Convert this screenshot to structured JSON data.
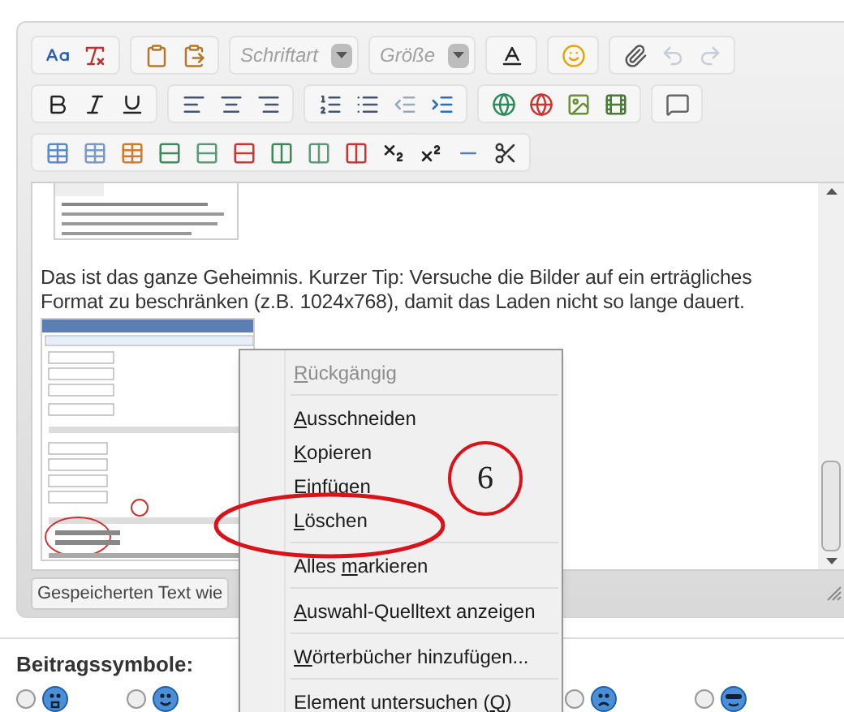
{
  "toolbar": {
    "font_select": {
      "placeholder": "Schriftart"
    },
    "size_select": {
      "placeholder": "Größe"
    },
    "undo": {
      "disabled": true
    },
    "redo": {
      "disabled": true
    }
  },
  "editor": {
    "paragraph": "Das ist das ganze Geheimnis. Kurzer Tip: Versuche die Bilder auf ein erträgliches Format zu beschränken (z.B. 1024x768), damit das Laden nicht so lange dauert.",
    "restore_button": "Gespeicherten Text wie"
  },
  "context_menu": {
    "items": [
      {
        "key": "R",
        "after": "ückgängig",
        "disabled": true,
        "separator_after": true
      },
      {
        "key": "A",
        "after": "usschneiden",
        "disabled": false,
        "separator_after": false
      },
      {
        "key": "K",
        "after": "opieren",
        "disabled": false,
        "separator_after": false
      },
      {
        "key": "E",
        "after": "infügen",
        "disabled": false,
        "separator_after": false
      },
      {
        "key": "L",
        "after": "öschen",
        "disabled": false,
        "separator_after": true
      },
      {
        "before": "Alles ",
        "key": "m",
        "after": "arkieren",
        "disabled": false,
        "separator_after": true
      },
      {
        "key": "A",
        "after": "uswahl-Quelltext anzeigen",
        "disabled": false,
        "separator_after": true
      },
      {
        "key": "W",
        "after": "örterbücher hinzufügen...",
        "disabled": false,
        "separator_after": true
      },
      {
        "before": "Element untersuchen (",
        "key": "Q",
        "after": ")",
        "disabled": false,
        "separator_after": false
      }
    ]
  },
  "annotation": {
    "number": "6"
  },
  "post_icons": {
    "title": "Beitragssymbole:",
    "options": [
      {
        "kind": "scared",
        "selected": false
      },
      {
        "kind": "smile",
        "selected": false
      },
      {
        "kind": "sad",
        "selected": false
      },
      {
        "kind": "cool",
        "selected": false
      }
    ]
  }
}
